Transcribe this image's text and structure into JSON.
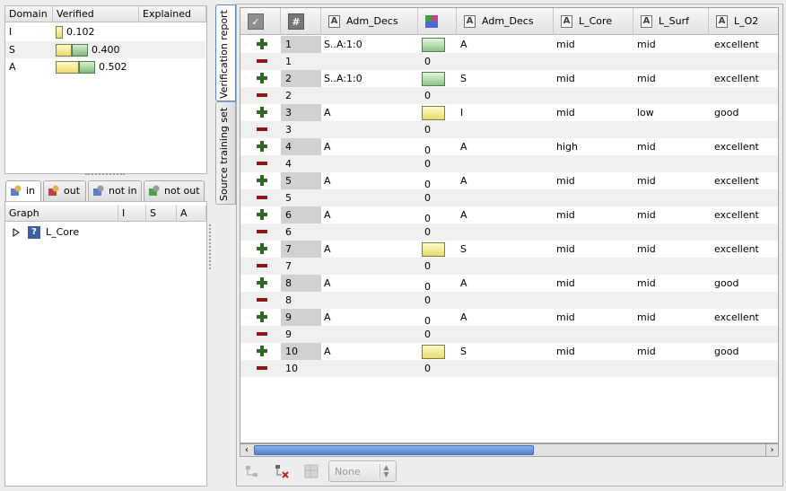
{
  "domain_table": {
    "columns": [
      "Domain",
      "Verified",
      "Explained"
    ],
    "rows": [
      {
        "domain": "I",
        "value": "0.102",
        "frac": 0.102
      },
      {
        "domain": "S",
        "value": "0.400",
        "frac": 0.4
      },
      {
        "domain": "A",
        "value": "0.502",
        "frac": 0.502
      }
    ]
  },
  "bottom_tabs": [
    "in",
    "out",
    "not in",
    "not out"
  ],
  "graph_table": {
    "columns": [
      "Graph",
      "I",
      "S",
      "A"
    ],
    "node": "L_Core"
  },
  "side_tabs": {
    "verification": "Verification report",
    "source": "Source training set"
  },
  "grid": {
    "headers": [
      "Adm_Decs",
      "Adm_Decs",
      "L_Core",
      "L_Surf",
      "L_O2"
    ],
    "rows": [
      {
        "num": "1",
        "adm": "S..A:1:0",
        "sw": "g",
        "adm2": "A",
        "core": "mid",
        "surf": "mid",
        "o2": "excellent"
      },
      {
        "num": "2",
        "adm": "S..A:1:0",
        "sw": "g",
        "adm2": "S",
        "core": "mid",
        "surf": "mid",
        "o2": "excellent"
      },
      {
        "num": "3",
        "adm": "A",
        "sw": "y",
        "adm2": "I",
        "core": "mid",
        "surf": "low",
        "o2": "good"
      },
      {
        "num": "4",
        "adm": "A",
        "sw": "0",
        "adm2": "A",
        "core": "high",
        "surf": "mid",
        "o2": "excellent"
      },
      {
        "num": "5",
        "adm": "A",
        "sw": "0",
        "adm2": "A",
        "core": "mid",
        "surf": "mid",
        "o2": "excellent"
      },
      {
        "num": "6",
        "adm": "A",
        "sw": "0",
        "adm2": "A",
        "core": "mid",
        "surf": "mid",
        "o2": "excellent"
      },
      {
        "num": "7",
        "adm": "A",
        "sw": "y",
        "adm2": "S",
        "core": "mid",
        "surf": "mid",
        "o2": "excellent"
      },
      {
        "num": "8",
        "adm": "A",
        "sw": "0",
        "adm2": "A",
        "core": "mid",
        "surf": "mid",
        "o2": "good"
      },
      {
        "num": "9",
        "adm": "A",
        "sw": "0",
        "adm2": "A",
        "core": "mid",
        "surf": "mid",
        "o2": "excellent"
      },
      {
        "num": "10",
        "adm": "A",
        "sw": "y",
        "adm2": "S",
        "core": "mid",
        "surf": "mid",
        "o2": "good"
      }
    ],
    "zero": "0"
  },
  "toolbar": {
    "select": "None"
  }
}
